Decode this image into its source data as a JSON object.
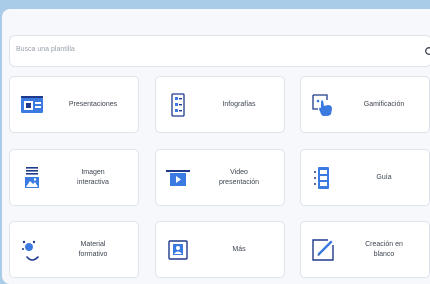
{
  "search": {
    "placeholder": "Busca una plantilla"
  },
  "templates": [
    {
      "label": "Presentaciones",
      "icon": "presentation-icon"
    },
    {
      "label": "Infografías",
      "icon": "infographic-icon"
    },
    {
      "label": "Gamificación",
      "icon": "gamification-icon"
    },
    {
      "label": "Imagen\ninteractiva",
      "icon": "interactive-image-icon"
    },
    {
      "label": "Video\npresentación",
      "icon": "video-presentation-icon"
    },
    {
      "label": "Guía",
      "icon": "guide-icon"
    },
    {
      "label": "Material\nformativo",
      "icon": "training-material-icon"
    },
    {
      "label": "Más",
      "icon": "more-icon"
    },
    {
      "label": "Creación en\nblanco",
      "icon": "blank-creation-icon"
    }
  ],
  "colors": {
    "accent": "#3b7ae0",
    "navy": "#1f3a8a",
    "text": "#3f4652"
  }
}
